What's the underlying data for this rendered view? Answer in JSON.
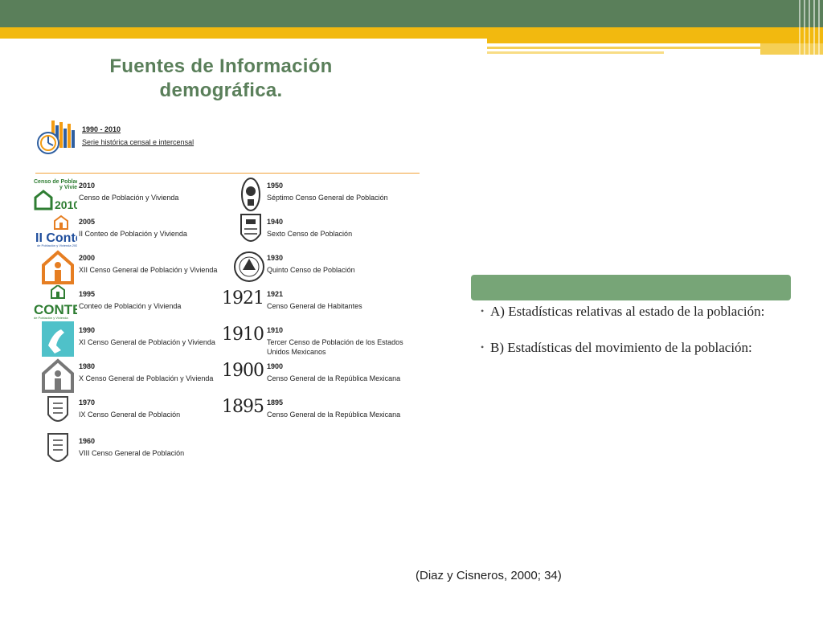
{
  "slide": {
    "title": "Fuentes de Información demográfica.",
    "citation": "(Diaz y Cisneros, 2000; 34)"
  },
  "census": {
    "historical": {
      "years": "1990 - 2010",
      "label": "Serie histórica censal e intercensal"
    },
    "left_column": [
      {
        "year": "2010",
        "label": "Censo de Población y Vivienda",
        "logo": "censo-2010-logo"
      },
      {
        "year": "2005",
        "label": "II Conteo de Población y Vivienda",
        "logo": "ii-conteo-logo"
      },
      {
        "year": "2000",
        "label": "XII Censo General de Población y Vivienda",
        "logo": "house-person-logo"
      },
      {
        "year": "1995",
        "label": "Conteo de Población y Vivienda",
        "logo": "conteo95-logo"
      },
      {
        "year": "1990",
        "label": "XI Censo General de Población y Vivienda",
        "logo": "hand-logo"
      },
      {
        "year": "1980",
        "label": "X Censo General de Población y Vivienda",
        "logo": "house-outline-logo"
      },
      {
        "year": "1970",
        "label": "IX Censo General de Población",
        "logo": "shield-logo"
      },
      {
        "year": "1960",
        "label": "VIII Censo General de Población",
        "logo": "shield-logo"
      }
    ],
    "right_column": [
      {
        "year": "1950",
        "label": "Séptimo Censo General de Población",
        "logo": "seal-logo"
      },
      {
        "year": "1940",
        "label": "Sexto Censo de Población",
        "logo": "shield-logo"
      },
      {
        "year": "1930",
        "label": "Quinto Censo de Población",
        "logo": "round-seal-logo"
      },
      {
        "year": "1921",
        "label": "Censo General de Habitantes",
        "mark": "1921"
      },
      {
        "year": "1910",
        "label": "Tercer Censo de Población de los Estados Unidos Mexicanos",
        "mark": "1910"
      },
      {
        "year": "1900",
        "label": "Censo General de la República Mexicana",
        "mark": "1900"
      },
      {
        "year": "1895",
        "label": "Censo General de la República Mexicana",
        "mark": "1895"
      }
    ]
  },
  "panel": {
    "bullets": [
      "A) Estadísticas relativas al estado de la población:",
      "B) Estadísticas del movimiento de la población:"
    ]
  },
  "colors": {
    "header_green": "#5a7f5a",
    "gold": "#f2b90f",
    "panel_green": "#77a577",
    "title_green": "#5a7f5a"
  }
}
